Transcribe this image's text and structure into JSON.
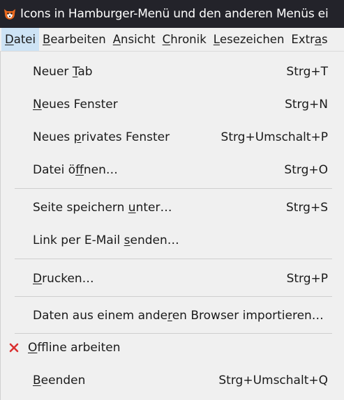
{
  "window": {
    "title": "Icons in Hamburger-Menü und den anderen Menüs ei",
    "app_icon": "firefox-fox-icon"
  },
  "menubar": {
    "items": [
      {
        "pre": "",
        "acc": "D",
        "post": "atei"
      },
      {
        "pre": "",
        "acc": "B",
        "post": "earbeiten"
      },
      {
        "pre": "",
        "acc": "A",
        "post": "nsicht"
      },
      {
        "pre": "",
        "acc": "C",
        "post": "hronik"
      },
      {
        "pre": "",
        "acc": "L",
        "post": "esezeichen"
      },
      {
        "pre": "Extr",
        "acc": "a",
        "post": "s"
      }
    ]
  },
  "file_menu": {
    "items": [
      {
        "pre": "Neuer ",
        "acc": "T",
        "post": "ab",
        "shortcut": "Strg+T"
      },
      {
        "pre": "",
        "acc": "N",
        "post": "eues Fenster",
        "shortcut": "Strg+N"
      },
      {
        "pre": "Neues ",
        "acc": "p",
        "post": "rivates Fenster",
        "shortcut": "Strg+Umschalt+P"
      },
      {
        "pre": "Datei ö",
        "acc": "f",
        "post": "fnen…",
        "shortcut": "Strg+O"
      },
      {
        "pre": "Seite speichern ",
        "acc": "u",
        "post": "nter…",
        "shortcut": "Strg+S"
      },
      {
        "pre": "Link per E-Mail ",
        "acc": "s",
        "post": "enden…",
        "shortcut": ""
      },
      {
        "pre": "",
        "acc": "D",
        "post": "rucken…",
        "shortcut": "Strg+P"
      },
      {
        "pre": "Daten aus einem ande",
        "acc": "r",
        "post": "en Browser importieren…",
        "shortcut": ""
      },
      {
        "pre": "",
        "acc": "O",
        "post": "ffline arbeiten",
        "shortcut": "",
        "checked_icon": "x-mark-icon"
      },
      {
        "pre": "",
        "acc": "B",
        "post": "eenden",
        "shortcut": "Strg+Umschalt+Q"
      }
    ]
  },
  "colors": {
    "titlebar_bg": "#23232a",
    "menu_bg": "#f0f0f0",
    "active_menubar_bg": "#cde3f5",
    "check_mark": "#d93030"
  }
}
